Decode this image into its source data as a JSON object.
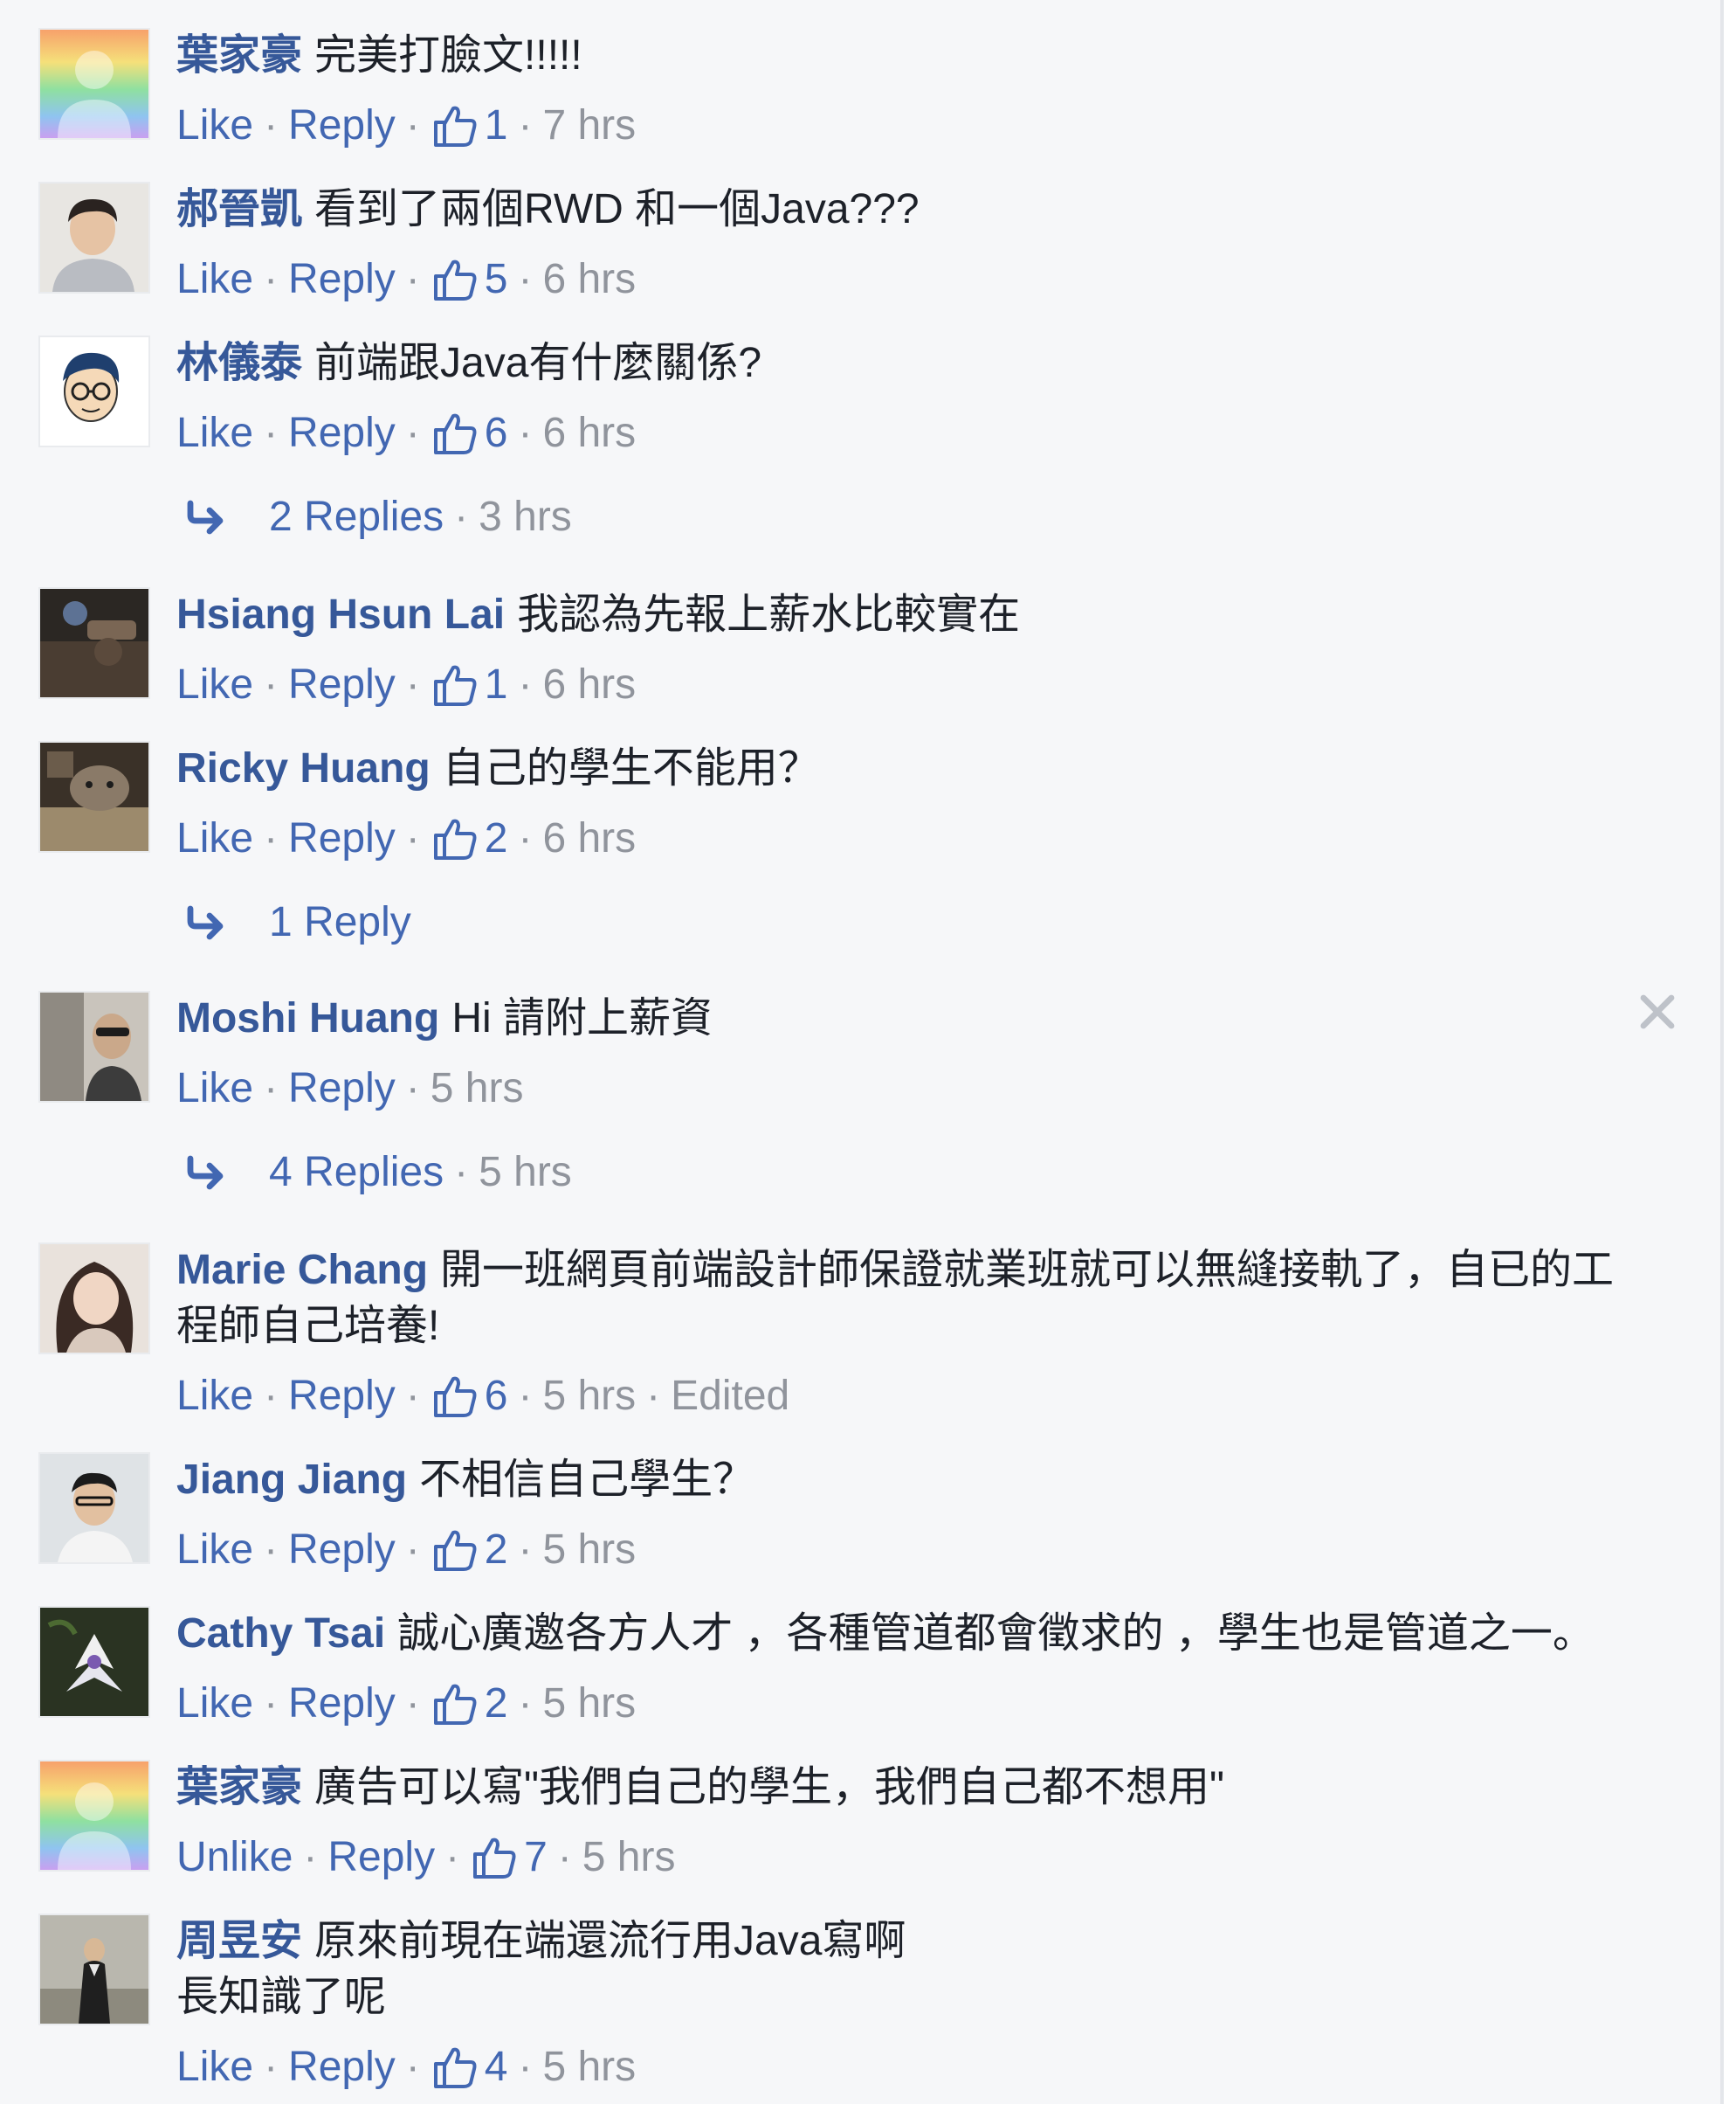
{
  "labels": {
    "like": "Like",
    "unlike": "Unlike",
    "reply": "Reply",
    "separator": "·"
  },
  "colors": {
    "author": "#365899",
    "link": "#4267b2",
    "meta": "#90949c",
    "text": "#1d2129",
    "background": "#f6f7f9"
  },
  "comments": [
    {
      "author": "葉家豪",
      "text": "完美打臉文!!!!!",
      "like_label": "Like",
      "likes": "1",
      "time": "7 hrs",
      "avatar": "rainbow-avatar"
    },
    {
      "author": "郝晉凱",
      "text": "看到了兩個RWD 和一個Java???",
      "like_label": "Like",
      "likes": "5",
      "time": "6 hrs",
      "avatar": "photo-avatar"
    },
    {
      "author": "林儀泰",
      "text": "前端跟Java有什麼關係?",
      "like_label": "Like",
      "likes": "6",
      "time": "6 hrs",
      "avatar": "cartoon-avatar"
    },
    {
      "author": "Hsiang Hsun Lai",
      "text": "我認為先報上薪水比較實在",
      "like_label": "Like",
      "likes": "1",
      "time": "6 hrs",
      "avatar": "photo-avatar"
    },
    {
      "author": "Ricky Huang",
      "text": "自己的學生不能用？",
      "like_label": "Like",
      "likes": "2",
      "time": "6 hrs",
      "avatar": "photo-avatar"
    },
    {
      "author": "Moshi Huang",
      "text": "Hi 請附上薪資",
      "like_label": "Like",
      "time": "5 hrs",
      "avatar": "photo-avatar"
    },
    {
      "author": "Marie Chang",
      "text": "開一班網頁前端設計師保證就業班就可以無縫接軌了，自已的工程師自己培養!",
      "like_label": "Like",
      "likes": "6",
      "time": "5 hrs",
      "edited": "Edited",
      "avatar": "photo-avatar"
    },
    {
      "author": "Jiang Jiang",
      "text": "不相信自己學生？",
      "like_label": "Like",
      "likes": "2",
      "time": "5 hrs",
      "avatar": "photo-avatar"
    },
    {
      "author": "Cathy Tsai",
      "text": "誠心廣邀各方人才 ，各種管道都會徵求的 ，學生也是管道之一。",
      "like_label": "Like",
      "likes": "2",
      "time": "5 hrs",
      "avatar": "photo-avatar"
    },
    {
      "author": "葉家豪",
      "text": "廣告可以寫\"我們自己的學生，我們自己都不想用\"",
      "like_label": "Unlike",
      "likes": "7",
      "time": "5 hrs",
      "avatar": "rainbow-avatar"
    },
    {
      "author": "周昱安",
      "text_line1": "原來前現在端還流行用Java寫啊",
      "text_line2": "長知識了呢",
      "like_label": "Like",
      "likes": "4",
      "time": "5 hrs",
      "avatar": "photo-avatar"
    }
  ],
  "reply_threads": [
    {
      "label": "2 Replies",
      "time": "3 hrs"
    },
    {
      "label": "1 Reply"
    },
    {
      "label": "4 Replies",
      "time": "5 hrs"
    }
  ],
  "icons": {
    "like": "thumbs-up-icon",
    "reply_thread": "reply-arrow-icon",
    "close": "close-icon"
  }
}
